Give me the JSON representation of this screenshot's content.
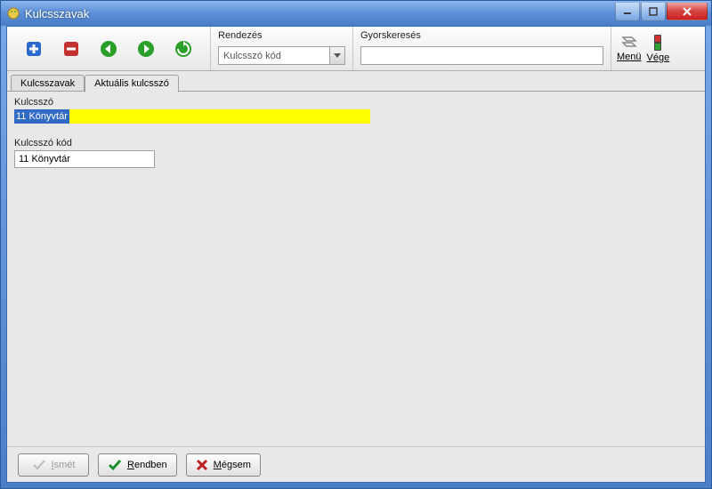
{
  "window": {
    "title": "Kulcsszavak"
  },
  "toolbar": {
    "sort": {
      "label": "Rendezés",
      "value": "Kulcsszó kód"
    },
    "search": {
      "label": "Gyorskeresés",
      "value": ""
    },
    "menu_label": "Menü",
    "end_label": "Vége"
  },
  "tabs": [
    {
      "label": "Kulcsszavak"
    },
    {
      "label": "Aktuális kulcsszó"
    }
  ],
  "form": {
    "kulcsszo_label": "Kulcsszó",
    "kulcsszo_value": "11 Könyvtár",
    "kod_label": "Kulcsszó kód",
    "kod_value": "11 Könyvtár"
  },
  "buttons": {
    "ismet": "Ismét",
    "rendben": "Rendben",
    "megsem": "Mégsem"
  }
}
